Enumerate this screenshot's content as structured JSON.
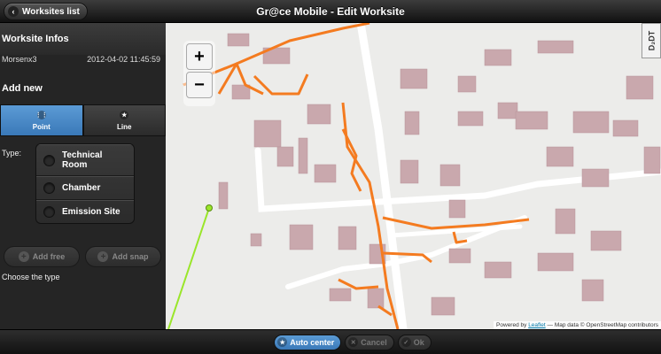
{
  "header": {
    "back_label": "Worksites list",
    "title": "Gr@ce Mobile - Edit Worksite"
  },
  "sidebar": {
    "info_title": "Worksite Infos",
    "worksite_name": "Morsenx3",
    "worksite_date": "2012-04-02 11:45:59",
    "add_title": "Add new",
    "modes": [
      {
        "label": "Point",
        "icon": "grid-icon",
        "active": true
      },
      {
        "label": "Line",
        "icon": "star-icon",
        "active": false
      }
    ],
    "type_label": "Type:",
    "types": [
      {
        "label": "Technical Room"
      },
      {
        "label": "Chamber"
      },
      {
        "label": "Emission Site"
      }
    ],
    "add_free_label": "Add free",
    "add_snap_label": "Add snap",
    "hint": "Choose the type"
  },
  "map": {
    "zoom_in": "+",
    "zoom_out": "−",
    "logo_text": "D₂DT",
    "attribution_prefix": "Powered by",
    "attribution_link": "Leaflet",
    "attribution_suffix": "— Map data © OpenStreetMap contributors",
    "colors": {
      "background": "#ececea",
      "building": "#c9a8ad",
      "road": "#ffffff",
      "network": "#f47b20",
      "line": "#9ae62a"
    }
  },
  "footer": {
    "auto_center_label": "Auto center",
    "cancel_label": "Cancel",
    "ok_label": "Ok"
  }
}
